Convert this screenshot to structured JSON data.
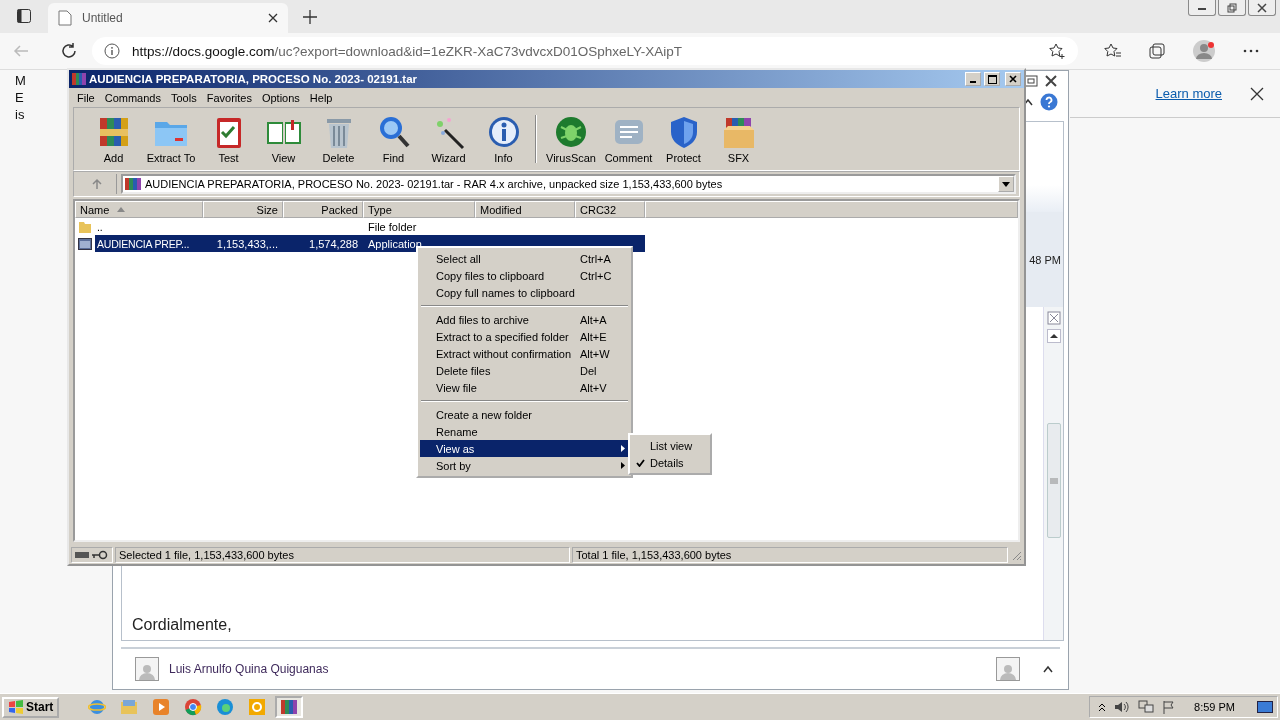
{
  "browser": {
    "tab_title": "Untitled",
    "url_host": "https://docs.google.com",
    "url_path": "/uc?export=download&id=1eZKR-XaC73vdvcxD01OSphxeLY-XAipT"
  },
  "page": {
    "left_letters": [
      "M",
      "E",
      "is"
    ],
    "learn_more": "Learn more"
  },
  "mail": {
    "time": "48 PM",
    "closing": "Cordialmente,",
    "sender": "Luis Arnulfo Quina Quiguanas"
  },
  "winrar": {
    "title": "AUDIENCIA PREPARATORIA, PROCESO No. 2023- 02191.tar",
    "menu": [
      "File",
      "Commands",
      "Tools",
      "Favorites",
      "Options",
      "Help"
    ],
    "toolbar": [
      [
        {
          "label": "Add",
          "kind": "add"
        },
        {
          "label": "Extract To",
          "kind": "extract"
        },
        {
          "label": "Test",
          "kind": "test"
        },
        {
          "label": "View",
          "kind": "view"
        },
        {
          "label": "Delete",
          "kind": "delete"
        },
        {
          "label": "Find",
          "kind": "find"
        },
        {
          "label": "Wizard",
          "kind": "wizard"
        },
        {
          "label": "Info",
          "kind": "info"
        }
      ],
      [
        {
          "label": "VirusScan",
          "kind": "virus"
        },
        {
          "label": "Comment",
          "kind": "comment"
        },
        {
          "label": "Protect",
          "kind": "protect"
        },
        {
          "label": "SFX",
          "kind": "sfx"
        }
      ]
    ],
    "address": "AUDIENCIA PREPARATORIA, PROCESO No. 2023- 02191.tar - RAR 4.x archive, unpacked size 1,153,433,600 bytes",
    "columns": [
      {
        "label": "Name",
        "kind": "text",
        "sorted": true
      },
      {
        "label": "Size",
        "kind": "number",
        "sorted": false
      },
      {
        "label": "Packed",
        "kind": "number",
        "sorted": false
      },
      {
        "label": "Type",
        "kind": "text",
        "sorted": false
      },
      {
        "label": "Modified",
        "kind": "text",
        "sorted": false
      },
      {
        "label": "CRC32",
        "kind": "text",
        "sorted": false
      }
    ],
    "rows": [
      {
        "kind": "folder",
        "selected": false,
        "cells": [
          "..",
          "",
          "",
          "File folder",
          "",
          ""
        ]
      },
      {
        "kind": "file",
        "selected": true,
        "cells": [
          "AUDIENCIA PREP...",
          "1,153,433,...",
          "1,574,288",
          "Application"
        ]
      }
    ],
    "status_left": "Selected 1 file, 1,153,433,600 bytes",
    "status_right": "Total 1 file, 1,153,433,600 bytes"
  },
  "context_menu": {
    "groups": [
      [
        {
          "label": "Select all",
          "shortcut": "Ctrl+A",
          "selected": false,
          "submenu": false
        },
        {
          "label": "Copy files to clipboard",
          "shortcut": "Ctrl+C",
          "selected": false,
          "submenu": false
        },
        {
          "label": "Copy full names to clipboard",
          "selected": false,
          "submenu": false
        }
      ],
      [
        {
          "label": "Add files to archive",
          "shortcut": "Alt+A",
          "selected": false,
          "submenu": false
        },
        {
          "label": "Extract to a specified folder",
          "shortcut": "Alt+E",
          "selected": false,
          "submenu": false
        },
        {
          "label": "Extract without confirmation",
          "shortcut": "Alt+W",
          "selected": false,
          "submenu": false
        },
        {
          "label": "Delete files",
          "shortcut": "Del",
          "selected": false,
          "submenu": false
        },
        {
          "label": "View file",
          "shortcut": "Alt+V",
          "selected": false,
          "submenu": false
        }
      ],
      [
        {
          "label": "Create a new folder",
          "selected": false,
          "submenu": false
        },
        {
          "label": "Rename",
          "selected": false,
          "submenu": false
        },
        {
          "label": "View as",
          "selected": true,
          "submenu": true
        },
        {
          "label": "Sort by",
          "selected": false,
          "submenu": true
        }
      ]
    ]
  },
  "submenu": {
    "items": [
      {
        "label": "List view",
        "checked": false
      },
      {
        "label": "Details",
        "checked": true
      }
    ]
  },
  "taskbar": {
    "start": "Start",
    "apps": [
      {
        "kind": "ie",
        "selected": false
      },
      {
        "kind": "explorer",
        "selected": false
      },
      {
        "kind": "media",
        "selected": false
      },
      {
        "kind": "chrome",
        "selected": false
      },
      {
        "kind": "edge",
        "selected": false
      },
      {
        "kind": "outlook",
        "selected": false
      },
      {
        "kind": "winrar",
        "selected": true
      }
    ],
    "clock": "8:59 PM"
  }
}
